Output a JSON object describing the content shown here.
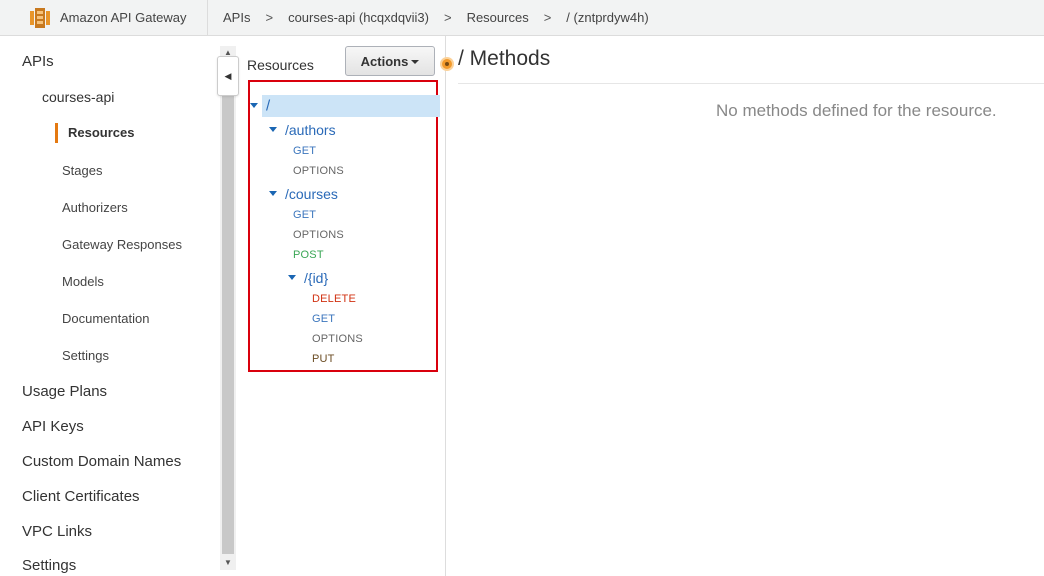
{
  "app": {
    "name": "Amazon API Gateway"
  },
  "breadcrumb": [
    "APIs",
    "courses-api (hcqxdqvii3)",
    "Resources",
    "/ (zntprdyw4h)"
  ],
  "breadcrumb_separator": ">",
  "leftnav": {
    "apis_label": "APIs",
    "api_name": "courses-api",
    "sub_items": [
      "Resources",
      "Stages",
      "Authorizers",
      "Gateway Responses",
      "Models",
      "Documentation",
      "Settings"
    ],
    "active_item": "Resources",
    "top_items": [
      "Usage Plans",
      "API Keys",
      "Custom Domain Names",
      "Client Certificates",
      "VPC Links",
      "Settings"
    ]
  },
  "resources_panel": {
    "title": "Resources",
    "actions_label": "Actions",
    "tree": {
      "root": "/",
      "authors": {
        "path": "/authors",
        "methods": [
          "GET",
          "OPTIONS"
        ]
      },
      "courses": {
        "path": "/courses",
        "methods": [
          "GET",
          "OPTIONS",
          "POST"
        ]
      },
      "id": {
        "path": "/{id}",
        "methods": [
          "DELETE",
          "GET",
          "OPTIONS",
          "PUT"
        ]
      }
    }
  },
  "main": {
    "title": "/ Methods",
    "empty_message": "No methods defined for the resource."
  },
  "colors": {
    "accent": "#e47911",
    "link": "#2a6ab8",
    "highlight_border": "#d9000d",
    "post": "#3aa655",
    "delete": "#d13212"
  }
}
